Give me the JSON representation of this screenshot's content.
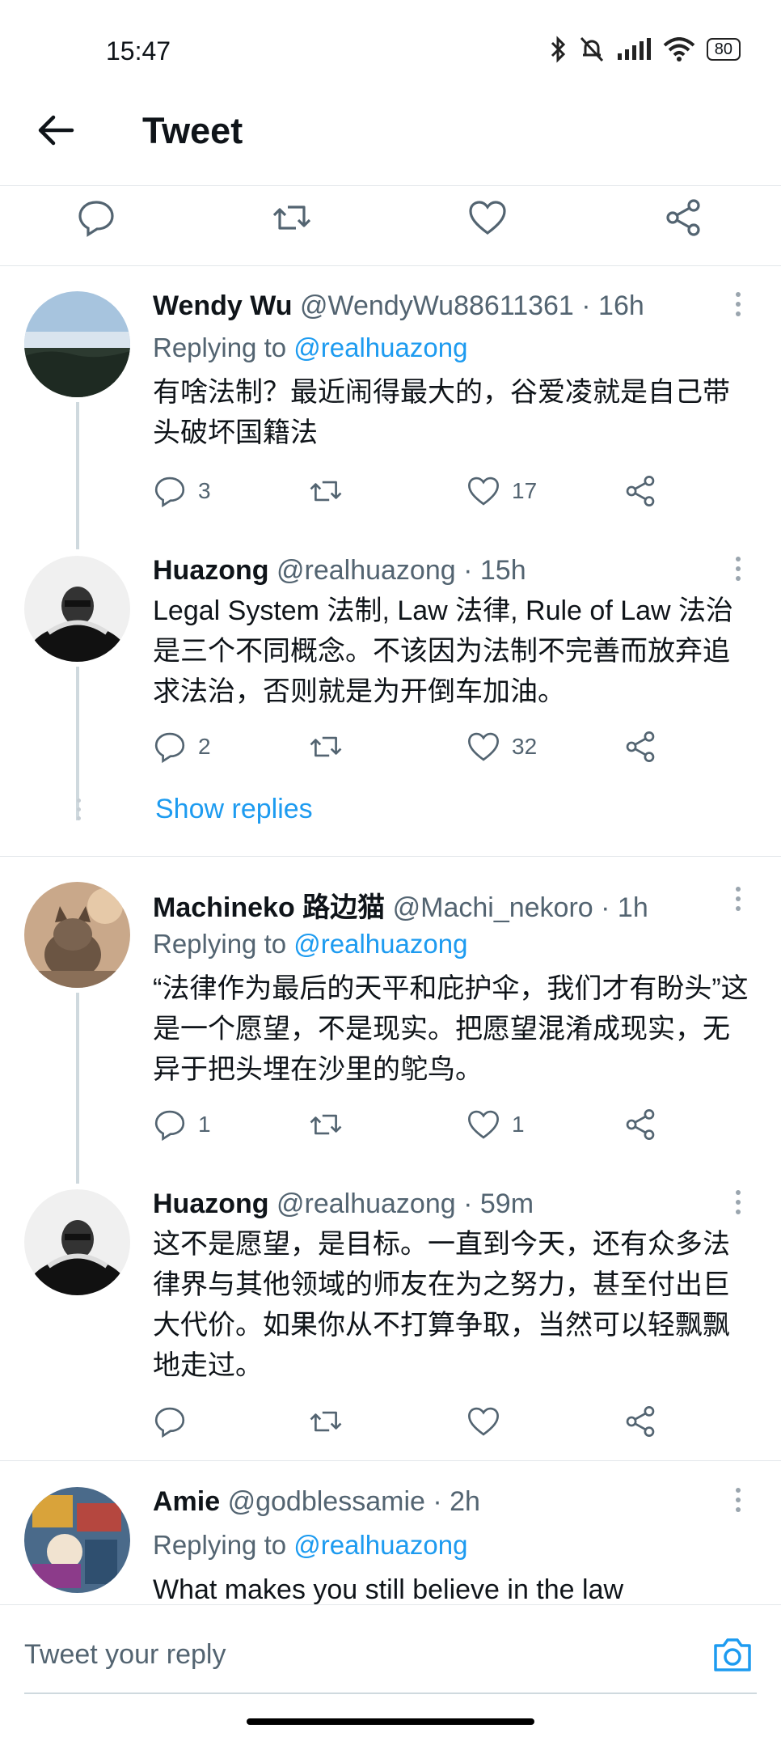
{
  "status_bar": {
    "time": "15:47",
    "battery": "80"
  },
  "header": {
    "title": "Tweet"
  },
  "tweets": [
    {
      "name": "Wendy Wu",
      "handle": "@WendyWu88611361 · 16h",
      "replying_label": "Replying to",
      "replying_to": "@realhuazong",
      "text": "有啥法制？最近闹得最大的，谷爱凌就是自己带头破坏国籍法",
      "replies": "3",
      "retweets": "",
      "likes": "17"
    },
    {
      "name": "Huazong",
      "handle": "@realhuazong · 15h",
      "text": "Legal System 法制, Law 法律, Rule of Law 法治 是三个不同概念。不该因为法制不完善而放弃追求法治，否则就是为开倒车加油。",
      "replies": "2",
      "retweets": "",
      "likes": "32"
    },
    {
      "name": "Machineko 路边猫",
      "handle": "@Machi_nekoro · 1h",
      "replying_label": "Replying to",
      "replying_to": "@realhuazong",
      "text": "“法律作为最后的天平和庇护伞，我们才有盼头”这是一个愿望，不是现实。把愿望混淆成现实，无异于把头埋在沙里的鸵鸟。",
      "replies": "1",
      "retweets": "",
      "likes": "1"
    },
    {
      "name": "Huazong",
      "handle": "@realhuazong · 59m",
      "text": "这不是愿望，是目标。一直到今天，还有众多法律界与其他领域的师友在为之努力，甚至付出巨大代价。如果你从不打算争取，当然可以轻飘飘地走过。",
      "replies": "",
      "retweets": "",
      "likes": ""
    },
    {
      "name": "Amie",
      "handle": "@godblessamie · 2h",
      "replying_label": "Replying to",
      "replying_to": "@realhuazong",
      "text": "What makes you still believe in the law"
    }
  ],
  "show_replies": "Show replies",
  "composer": {
    "placeholder": "Tweet your reply"
  }
}
